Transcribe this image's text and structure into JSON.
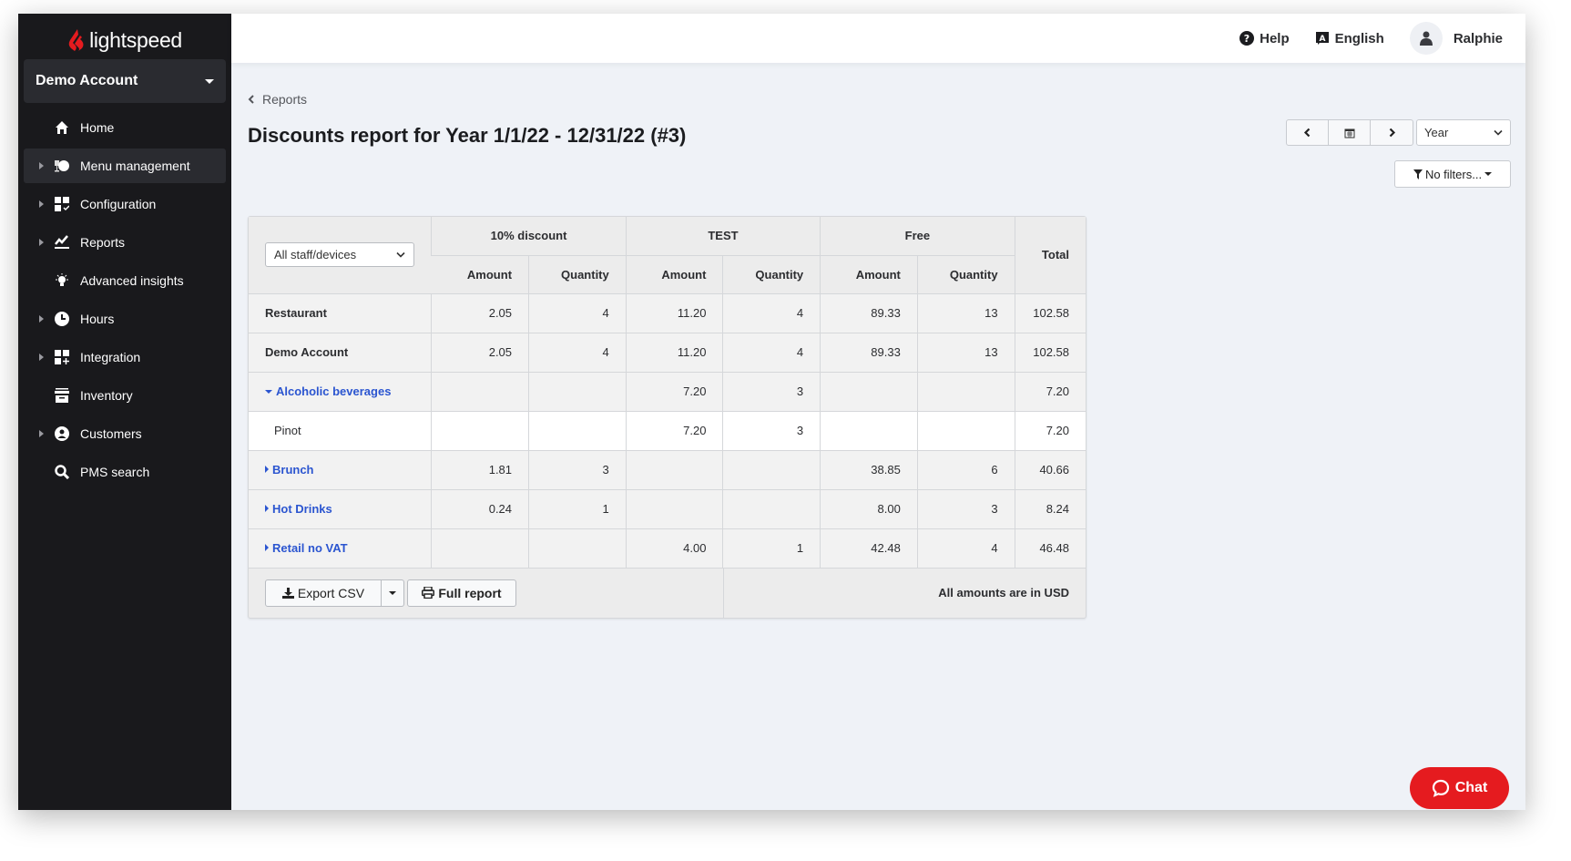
{
  "brand": {
    "name": "lightspeed",
    "accent": "#e51b1f"
  },
  "account": {
    "name": "Demo Account"
  },
  "sidebar": {
    "items": [
      {
        "label": "Home",
        "icon": "home-icon",
        "expandable": false,
        "active": false
      },
      {
        "label": "Menu management",
        "icon": "menu-management-icon",
        "expandable": true,
        "active": true
      },
      {
        "label": "Configuration",
        "icon": "configuration-icon",
        "expandable": true,
        "active": false
      },
      {
        "label": "Reports",
        "icon": "reports-icon",
        "expandable": true,
        "active": false
      },
      {
        "label": "Advanced insights",
        "icon": "lightbulb-icon",
        "expandable": false,
        "active": false
      },
      {
        "label": "Hours",
        "icon": "clock-icon",
        "expandable": true,
        "active": false
      },
      {
        "label": "Integration",
        "icon": "integration-icon",
        "expandable": true,
        "active": false
      },
      {
        "label": "Inventory",
        "icon": "inventory-icon",
        "expandable": false,
        "active": false
      },
      {
        "label": "Customers",
        "icon": "customer-icon",
        "expandable": true,
        "active": false
      },
      {
        "label": "PMS search",
        "icon": "search-icon",
        "expandable": false,
        "active": false
      }
    ]
  },
  "header": {
    "help_label": "Help",
    "language_label": "English",
    "user_name": "Ralphie"
  },
  "page": {
    "breadcrumb": "Reports",
    "title": "Discounts report for Year 1/1/22 - 12/31/22 (#3)",
    "period_select": "Year",
    "filters_label": "No filters..."
  },
  "report": {
    "staff_select": "All staff/devices",
    "groups": [
      "10% discount",
      "TEST",
      "Free"
    ],
    "sub_headers": {
      "amount": "Amount",
      "quantity": "Quantity"
    },
    "total_header": "Total",
    "rows": [
      {
        "label": "Restaurant",
        "type": "bold",
        "values": [
          "2.05",
          "4",
          "11.20",
          "4",
          "89.33",
          "13",
          "102.58"
        ]
      },
      {
        "label": "Demo Account",
        "type": "bold",
        "values": [
          "2.05",
          "4",
          "11.20",
          "4",
          "89.33",
          "13",
          "102.58"
        ]
      },
      {
        "label": "Alcoholic beverages",
        "type": "expanded",
        "values": [
          "",
          "",
          "7.20",
          "3",
          "",
          "",
          "7.20"
        ]
      },
      {
        "label": "Pinot",
        "type": "item",
        "values": [
          "",
          "",
          "7.20",
          "3",
          "",
          "",
          "7.20"
        ]
      },
      {
        "label": "Brunch",
        "type": "collapsed",
        "values": [
          "1.81",
          "3",
          "",
          "",
          "38.85",
          "6",
          "40.66"
        ]
      },
      {
        "label": "Hot Drinks",
        "type": "collapsed",
        "values": [
          "0.24",
          "1",
          "",
          "",
          "8.00",
          "3",
          "8.24"
        ]
      },
      {
        "label": "Retail no VAT",
        "type": "collapsed",
        "values": [
          "",
          "",
          "4.00",
          "1",
          "42.48",
          "4",
          "46.48"
        ]
      }
    ],
    "export_label": "Export CSV",
    "full_report_label": "Full report",
    "currency_note": "All amounts are in USD"
  },
  "chat": {
    "label": "Chat"
  }
}
